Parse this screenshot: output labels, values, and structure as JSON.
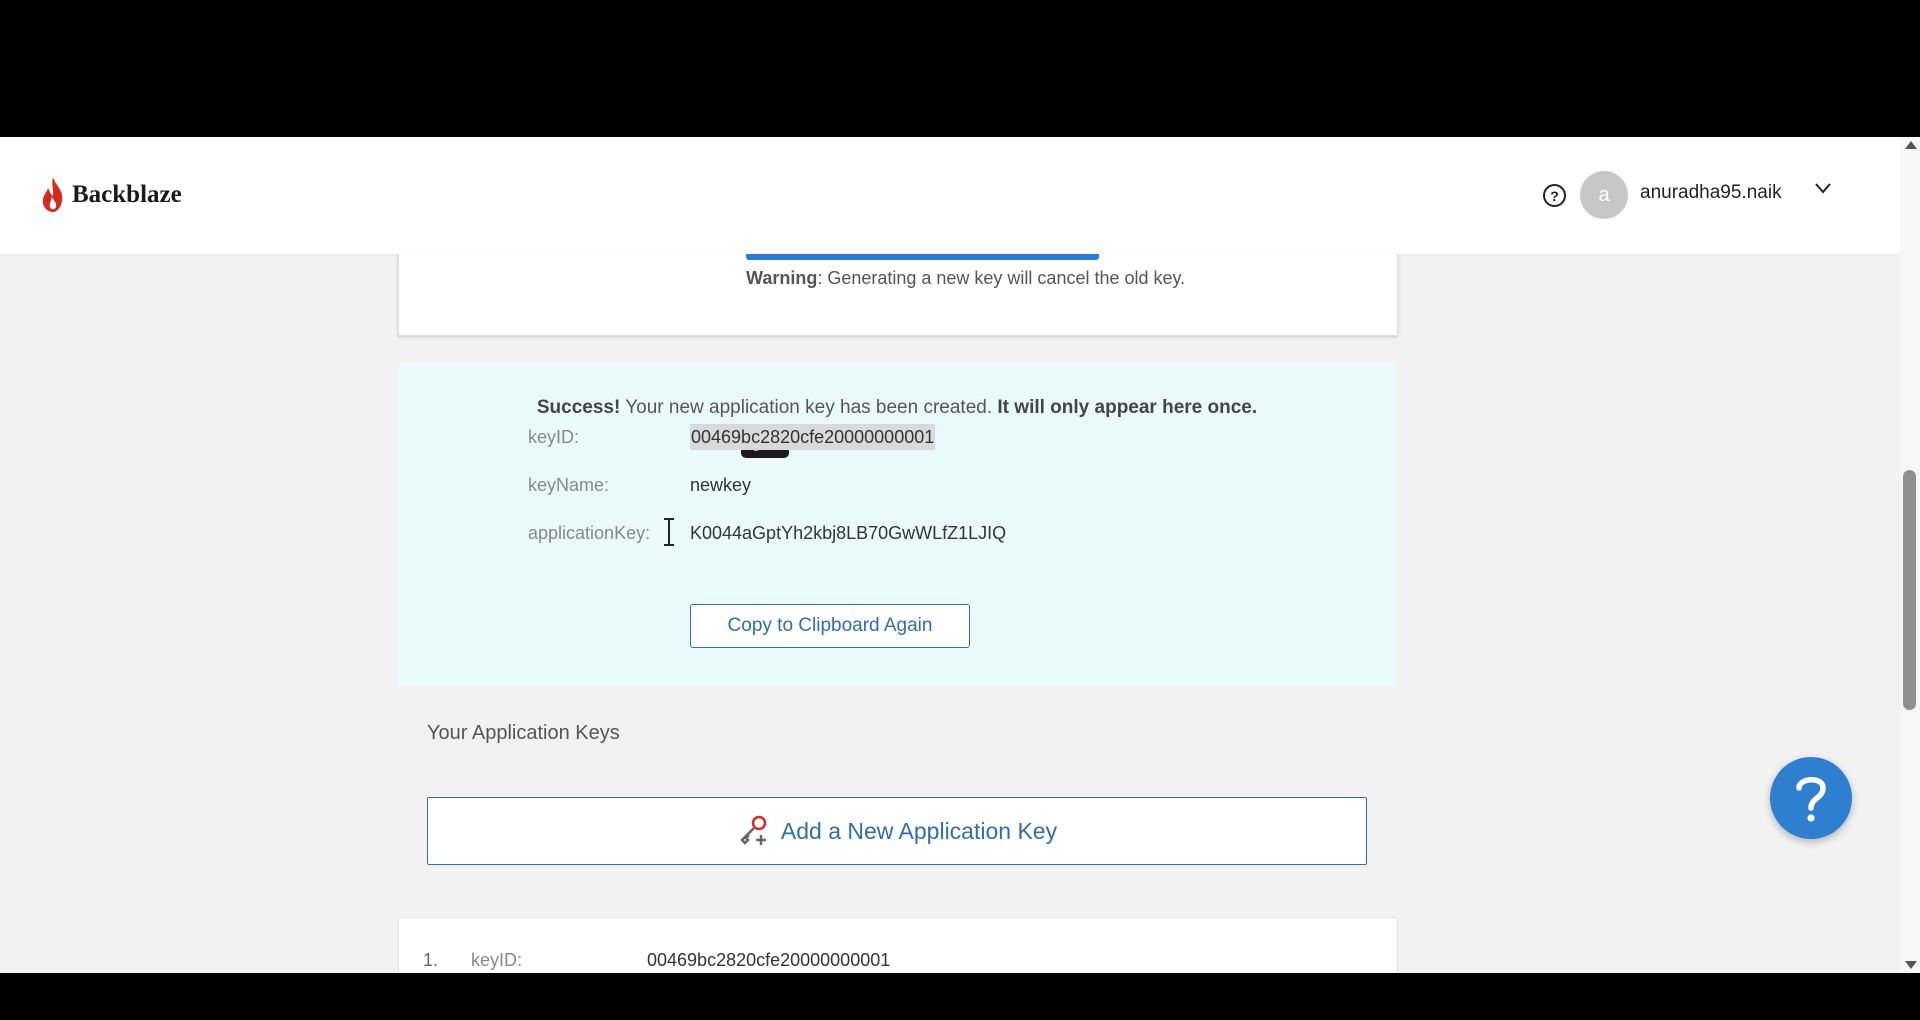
{
  "header": {
    "logo_text": "Backblaze",
    "help_glyph": "?",
    "avatar_letter": "a",
    "username": "anuradha95.naik"
  },
  "top_card": {
    "warning_label": "Warning",
    "warning_text": ": Generating a new key will cancel the old key."
  },
  "success": {
    "prefix": "Success!",
    "message": " Your new application key has been created. ",
    "emphasis": "It will only appear here once.",
    "rows": [
      {
        "label": "keyID:",
        "value": "00469bc2820cfe20000000001"
      },
      {
        "label": "keyName:",
        "value": "newkey"
      },
      {
        "label": "applicationKey:",
        "value": "K0044aGptYh2kbj8LB70GwWLfZ1LJIQ"
      }
    ],
    "copy_button": "Copy to Clipboard Again"
  },
  "keys_section": {
    "title": "Your Application Keys",
    "add_button": "Add a New Application Key",
    "items": [
      {
        "index": "1.",
        "label": "keyID:",
        "value": "00469bc2820cfe20000000001"
      }
    ]
  },
  "help_fab": "?",
  "colors": {
    "accent": "#2f6ea8",
    "brand_red": "#d52b1e",
    "success_bg": "#eafafc",
    "fab_blue": "#2f7fd0"
  }
}
